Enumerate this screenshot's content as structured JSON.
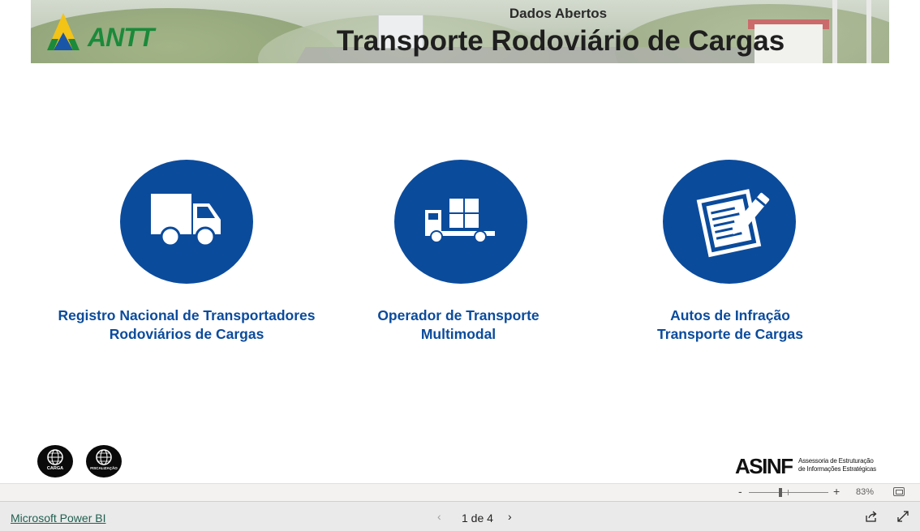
{
  "header": {
    "subtitle": "Dados Abertos",
    "title": "Transporte Rodoviário de Cargas",
    "logo_text": "ANTT"
  },
  "cards": [
    {
      "icon": "truck-icon",
      "line1": "Registro Nacional de Transportadores",
      "line2": "Rodoviários de Cargas"
    },
    {
      "icon": "cargo-truck-icon",
      "line1": "Operador de Transporte",
      "line2": "Multimodal"
    },
    {
      "icon": "infraction-document-icon",
      "line1": "Autos de Infração",
      "line2": "Transporte de Cargas"
    }
  ],
  "badges": [
    {
      "icon": "globe-icon",
      "label": "CARGA"
    },
    {
      "icon": "globe-icon",
      "label": "FISCALIZAÇÃO"
    }
  ],
  "footer_logo": {
    "main": "ASINF",
    "line1": "Assessoria de Estruturação",
    "line2": "de Informações Estratégicas"
  },
  "zoom": {
    "minus": "-",
    "plus": "+",
    "value": "83%"
  },
  "bottom_bar": {
    "link": "Microsoft Power BI",
    "prev": "‹",
    "page": "1 de 4",
    "next": "›"
  },
  "colors": {
    "brand_blue": "#0b4b9c",
    "antt_green": "#1b8a3a",
    "antt_yellow": "#f3c316",
    "antt_blue": "#1a56a8"
  }
}
